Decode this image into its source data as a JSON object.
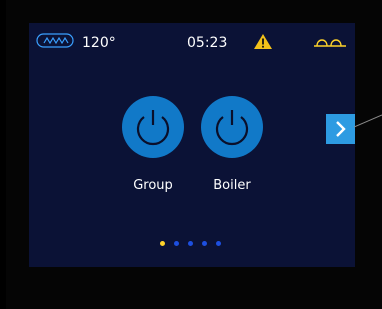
{
  "status": {
    "temperature": "120°",
    "time": "05:23",
    "icons": [
      "heating-wave-icon",
      "warning-icon",
      "cup-icon"
    ]
  },
  "buttons": [
    {
      "label": "Group",
      "icon": "power-icon"
    },
    {
      "label": "Boiler",
      "icon": "power-icon"
    }
  ],
  "navigation": {
    "next_icon": "chevron-right-icon"
  },
  "pagination": {
    "total": 5,
    "current": 1
  },
  "colors": {
    "screen_bg": "#0b1236",
    "button_blue": "#1179c8",
    "nav_blue": "#2d9be2",
    "accent_yellow": "#ffd32a",
    "dot_blue": "#1d4fe0"
  }
}
